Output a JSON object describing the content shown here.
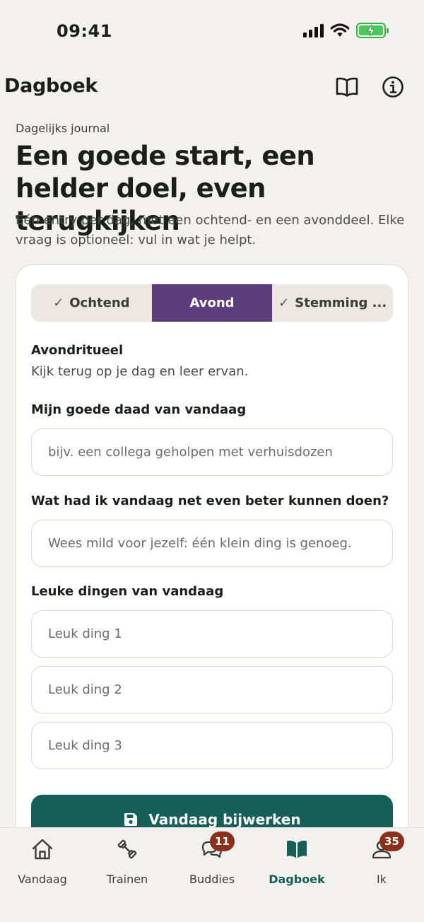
{
  "status_bar": {
    "time": "09:41"
  },
  "header": {
    "title": "Dagboek"
  },
  "intro": {
    "eyebrow": "Dagelijks journal",
    "title": "Een goede start, een helder doel, even terugkijken",
    "description": "Eén entry per dag, met een ochtend- en een avonddeel. Elke vraag is optioneel: vul in wat je helpt."
  },
  "segments": [
    {
      "label": "Ochtend",
      "check": "✓"
    },
    {
      "label": "Avond"
    },
    {
      "label": "Stemming ...",
      "check": "✓"
    }
  ],
  "ritual": {
    "title": "Avondritueel",
    "subtitle": "Kijk terug op je dag en leer ervan."
  },
  "good_deed": {
    "label": "Mijn goede daad van vandaag",
    "placeholder": "bijv. een collega geholpen met verhuisdozen"
  },
  "improve": {
    "label": "Wat had ik vandaag net even beter kunnen doen?",
    "placeholder": "Wees mild voor jezelf: één klein ding is genoeg."
  },
  "fun_things": {
    "label": "Leuke dingen van vandaag",
    "placeholders": [
      "Leuk ding 1",
      "Leuk ding 2",
      "Leuk ding 3"
    ]
  },
  "save_button": {
    "label": "Vandaag bijwerken"
  },
  "tabs": [
    {
      "label": "Vandaag",
      "icon": "home-icon"
    },
    {
      "label": "Trainen",
      "icon": "dumbbell-icon"
    },
    {
      "label": "Buddies",
      "icon": "chat-icon",
      "badge": "11"
    },
    {
      "label": "Dagboek",
      "icon": "book-icon"
    },
    {
      "label": "Ik",
      "icon": "user-icon",
      "badge": "35"
    }
  ],
  "colors": {
    "background": "#f3f1ed",
    "accent_purple": "#5e3d7e",
    "primary_teal": "#155f58",
    "badge": "#8c2f1d",
    "battery_green": "#38b34a"
  }
}
